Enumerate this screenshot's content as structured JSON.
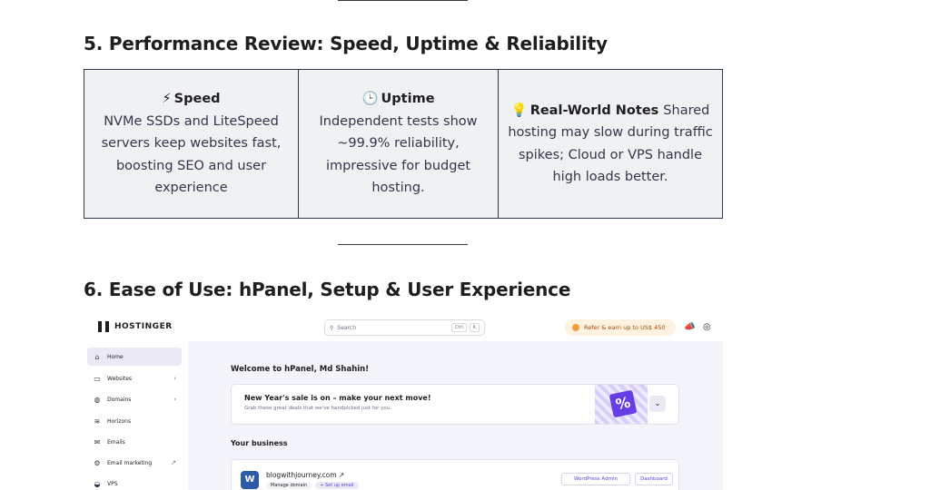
{
  "section5": {
    "heading": "5. Performance Review: Speed, Uptime & Reliability",
    "cells": [
      {
        "icon": "⚡",
        "title": "Speed",
        "body": "NVMe SSDs and LiteSpeed servers keep websites fast, boosting SEO and user experience"
      },
      {
        "icon": "🕒",
        "title": "Uptime",
        "body": "Independent tests show ~99.9% reliability, impressive for budget hosting."
      },
      {
        "icon": "💡",
        "title": "Real-World Notes",
        "body": "Shared hosting may slow during traffic spikes; Cloud or VPS handle high loads better."
      }
    ]
  },
  "section6": {
    "heading": "6. Ease of Use: hPanel, Setup & User Experience"
  },
  "hpanel": {
    "logo": "HOSTINGER",
    "search_placeholder": "Search",
    "search_keys": [
      "Ctrl",
      "K"
    ],
    "refer_label": "Refer & earn up to US$ 450",
    "sidebar": [
      {
        "label": "Home",
        "icon": "⌂",
        "active": true
      },
      {
        "label": "Websites",
        "icon": "▭",
        "chevron": "›"
      },
      {
        "label": "Domains",
        "icon": "◍",
        "chevron": "›"
      },
      {
        "label": "Horizons",
        "icon": "≋"
      },
      {
        "label": "Emails",
        "icon": "✉"
      },
      {
        "label": "Email marketing",
        "icon": "⚙",
        "external": "↗"
      },
      {
        "label": "VPS",
        "icon": "◒"
      }
    ],
    "welcome": "Welcome to hPanel, Md Shahin!",
    "promo": {
      "title": "New Year's sale is on – make your next move!",
      "subtitle": "Grab these great deals that we've handpicked just for you.",
      "badge": "%"
    },
    "business_title": "Your business",
    "site": {
      "name": "blogwithjourney.com",
      "external_icon": "↗",
      "tags": [
        "Manage domain",
        "+ Set up email"
      ],
      "buttons": [
        "WordPress Admin",
        "Dashboard"
      ]
    },
    "colors": {
      "accent": "#673de6",
      "refer_bg": "#fff2e0",
      "panel_bg": "#f4f4fb"
    }
  }
}
